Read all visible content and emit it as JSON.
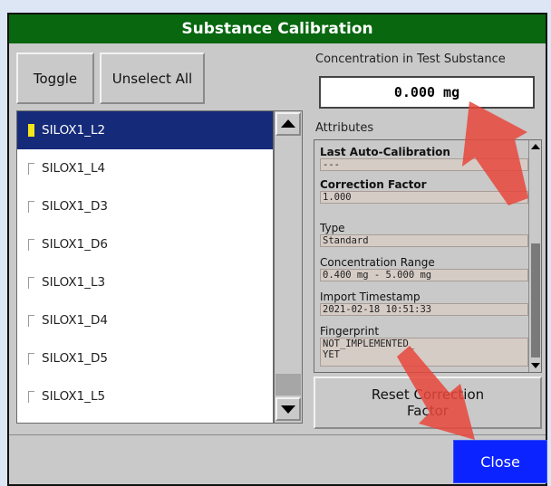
{
  "dialog": {
    "title": "Substance Calibration"
  },
  "buttons": {
    "toggle": "Toggle",
    "unselect_all": "Unselect All",
    "reset": "Reset Correction\nFactor",
    "close": "Close"
  },
  "list": {
    "items": [
      {
        "label": "SILOX1_L2",
        "selected": true
      },
      {
        "label": "SILOX1_L4",
        "selected": false
      },
      {
        "label": "SILOX1_D3",
        "selected": false
      },
      {
        "label": "SILOX1_D6",
        "selected": false
      },
      {
        "label": "SILOX1_L3",
        "selected": false
      },
      {
        "label": "SILOX1_D4",
        "selected": false
      },
      {
        "label": "SILOX1_D5",
        "selected": false
      },
      {
        "label": "SILOX1_L5",
        "selected": false
      }
    ]
  },
  "concentration": {
    "label": "Concentration in Test Substance",
    "value": "0.000 mg"
  },
  "attributes": {
    "label": "Attributes",
    "fields": [
      {
        "name": "Last Auto-Calibration",
        "bold": true,
        "value": "---"
      },
      {
        "name": "Correction Factor",
        "bold": true,
        "value": "1.000"
      },
      {
        "name": "Type",
        "bold": false,
        "value": "Standard"
      },
      {
        "name": "Concentration Range",
        "bold": false,
        "value": "0.400 mg - 5.000 mg"
      },
      {
        "name": "Import Timestamp",
        "bold": false,
        "value": "2021-02-18 10:51:33"
      },
      {
        "name": "Fingerprint",
        "bold": false,
        "value": "NOT_IMPLEMENTED_\nYET"
      }
    ]
  },
  "colors": {
    "title_bar": "#08670f",
    "close_button": "#0a23ff",
    "selected_row": "#162a7a",
    "annotation_arrow": "#e8463c"
  },
  "icons": {
    "scroll_up": "triangle-up",
    "scroll_down": "triangle-down",
    "checkbox": "checkbox-corner"
  }
}
